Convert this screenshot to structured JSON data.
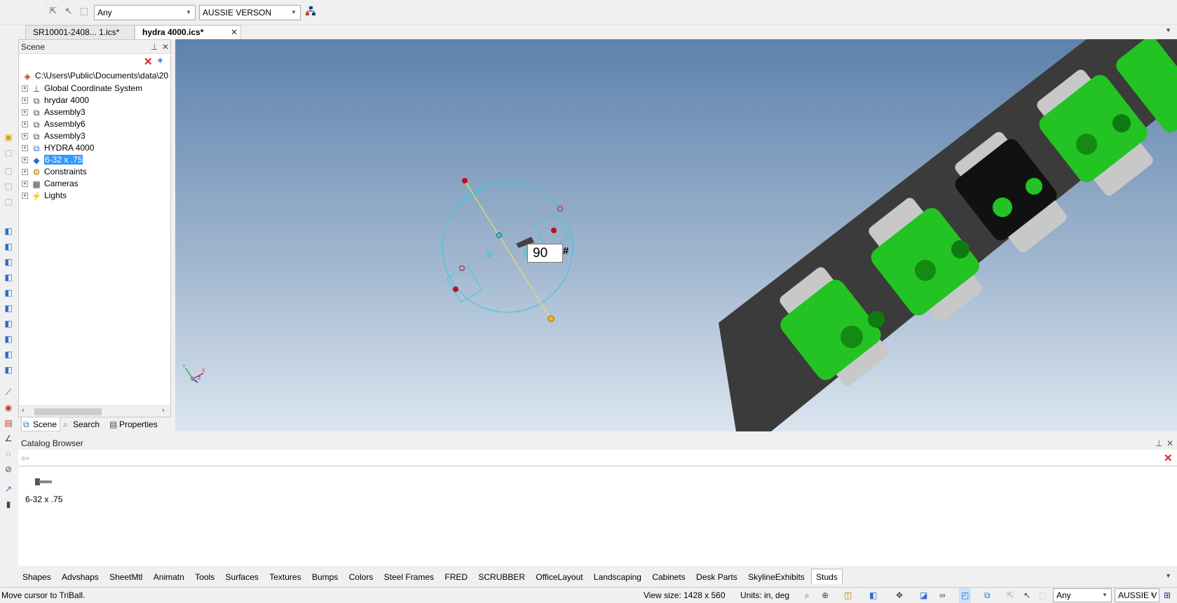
{
  "toolbar": {
    "filter_value": "Any",
    "config_value": "AUSSIE VERSON"
  },
  "doc_tabs": [
    {
      "label": "SR10001-2408... 1.ics*"
    },
    {
      "label": "hydra 4000.ics*"
    }
  ],
  "scene": {
    "title": "Scene",
    "root_path": "C:\\Users\\Public\\Documents\\data\\20",
    "items": [
      {
        "label": "Global Coordinate System",
        "icon": "axis-icon"
      },
      {
        "label": "hrydar 4000",
        "icon": "assembly-icon"
      },
      {
        "label": "Assembly3",
        "icon": "assembly-icon"
      },
      {
        "label": "Assembly6",
        "icon": "assembly-icon"
      },
      {
        "label": "Assembly3",
        "icon": "assembly-icon"
      },
      {
        "label": "HYDRA 4000",
        "icon": "assembly-icon"
      },
      {
        "label": "6-32 x .75",
        "icon": "part-icon",
        "selected": true
      },
      {
        "label": "Constraints",
        "icon": "constraint-icon"
      },
      {
        "label": "Cameras",
        "icon": "camera-icon"
      },
      {
        "label": "Lights",
        "icon": "light-icon"
      }
    ],
    "tabs": {
      "scene": "Scene",
      "search": "Search",
      "properties": "Properties"
    }
  },
  "viewport": {
    "angle_value": "90",
    "angle_suffix": "#",
    "left_digit": "9",
    "right_digit": "9"
  },
  "catalog": {
    "title": "Catalog Browser",
    "items": [
      {
        "label": "6-32 x .75"
      }
    ]
  },
  "bottom_tabs": [
    "Shapes",
    "Advshaps",
    "SheetMtl",
    "Animatn",
    "Tools",
    "Surfaces",
    "Textures",
    "Bumps",
    "Colors",
    "Steel Frames",
    "FRED",
    "SCRUBBER",
    "OfficeLayout",
    "Landscaping",
    "Cabinets",
    "Desk Parts",
    "SkylineExhibits",
    "Studs"
  ],
  "active_bottom_tab": "Studs",
  "status": {
    "message": "Move cursor to TriBall.",
    "view_size": "View size: 1428 x  560",
    "units": "Units: in, deg",
    "filter_value": "Any",
    "config_value": "AUSSIE V"
  },
  "colors": {
    "selection": "#3399ff",
    "part_green": "#22c323",
    "plate": "#3b3b3b",
    "triball": "#3ec9dc"
  }
}
